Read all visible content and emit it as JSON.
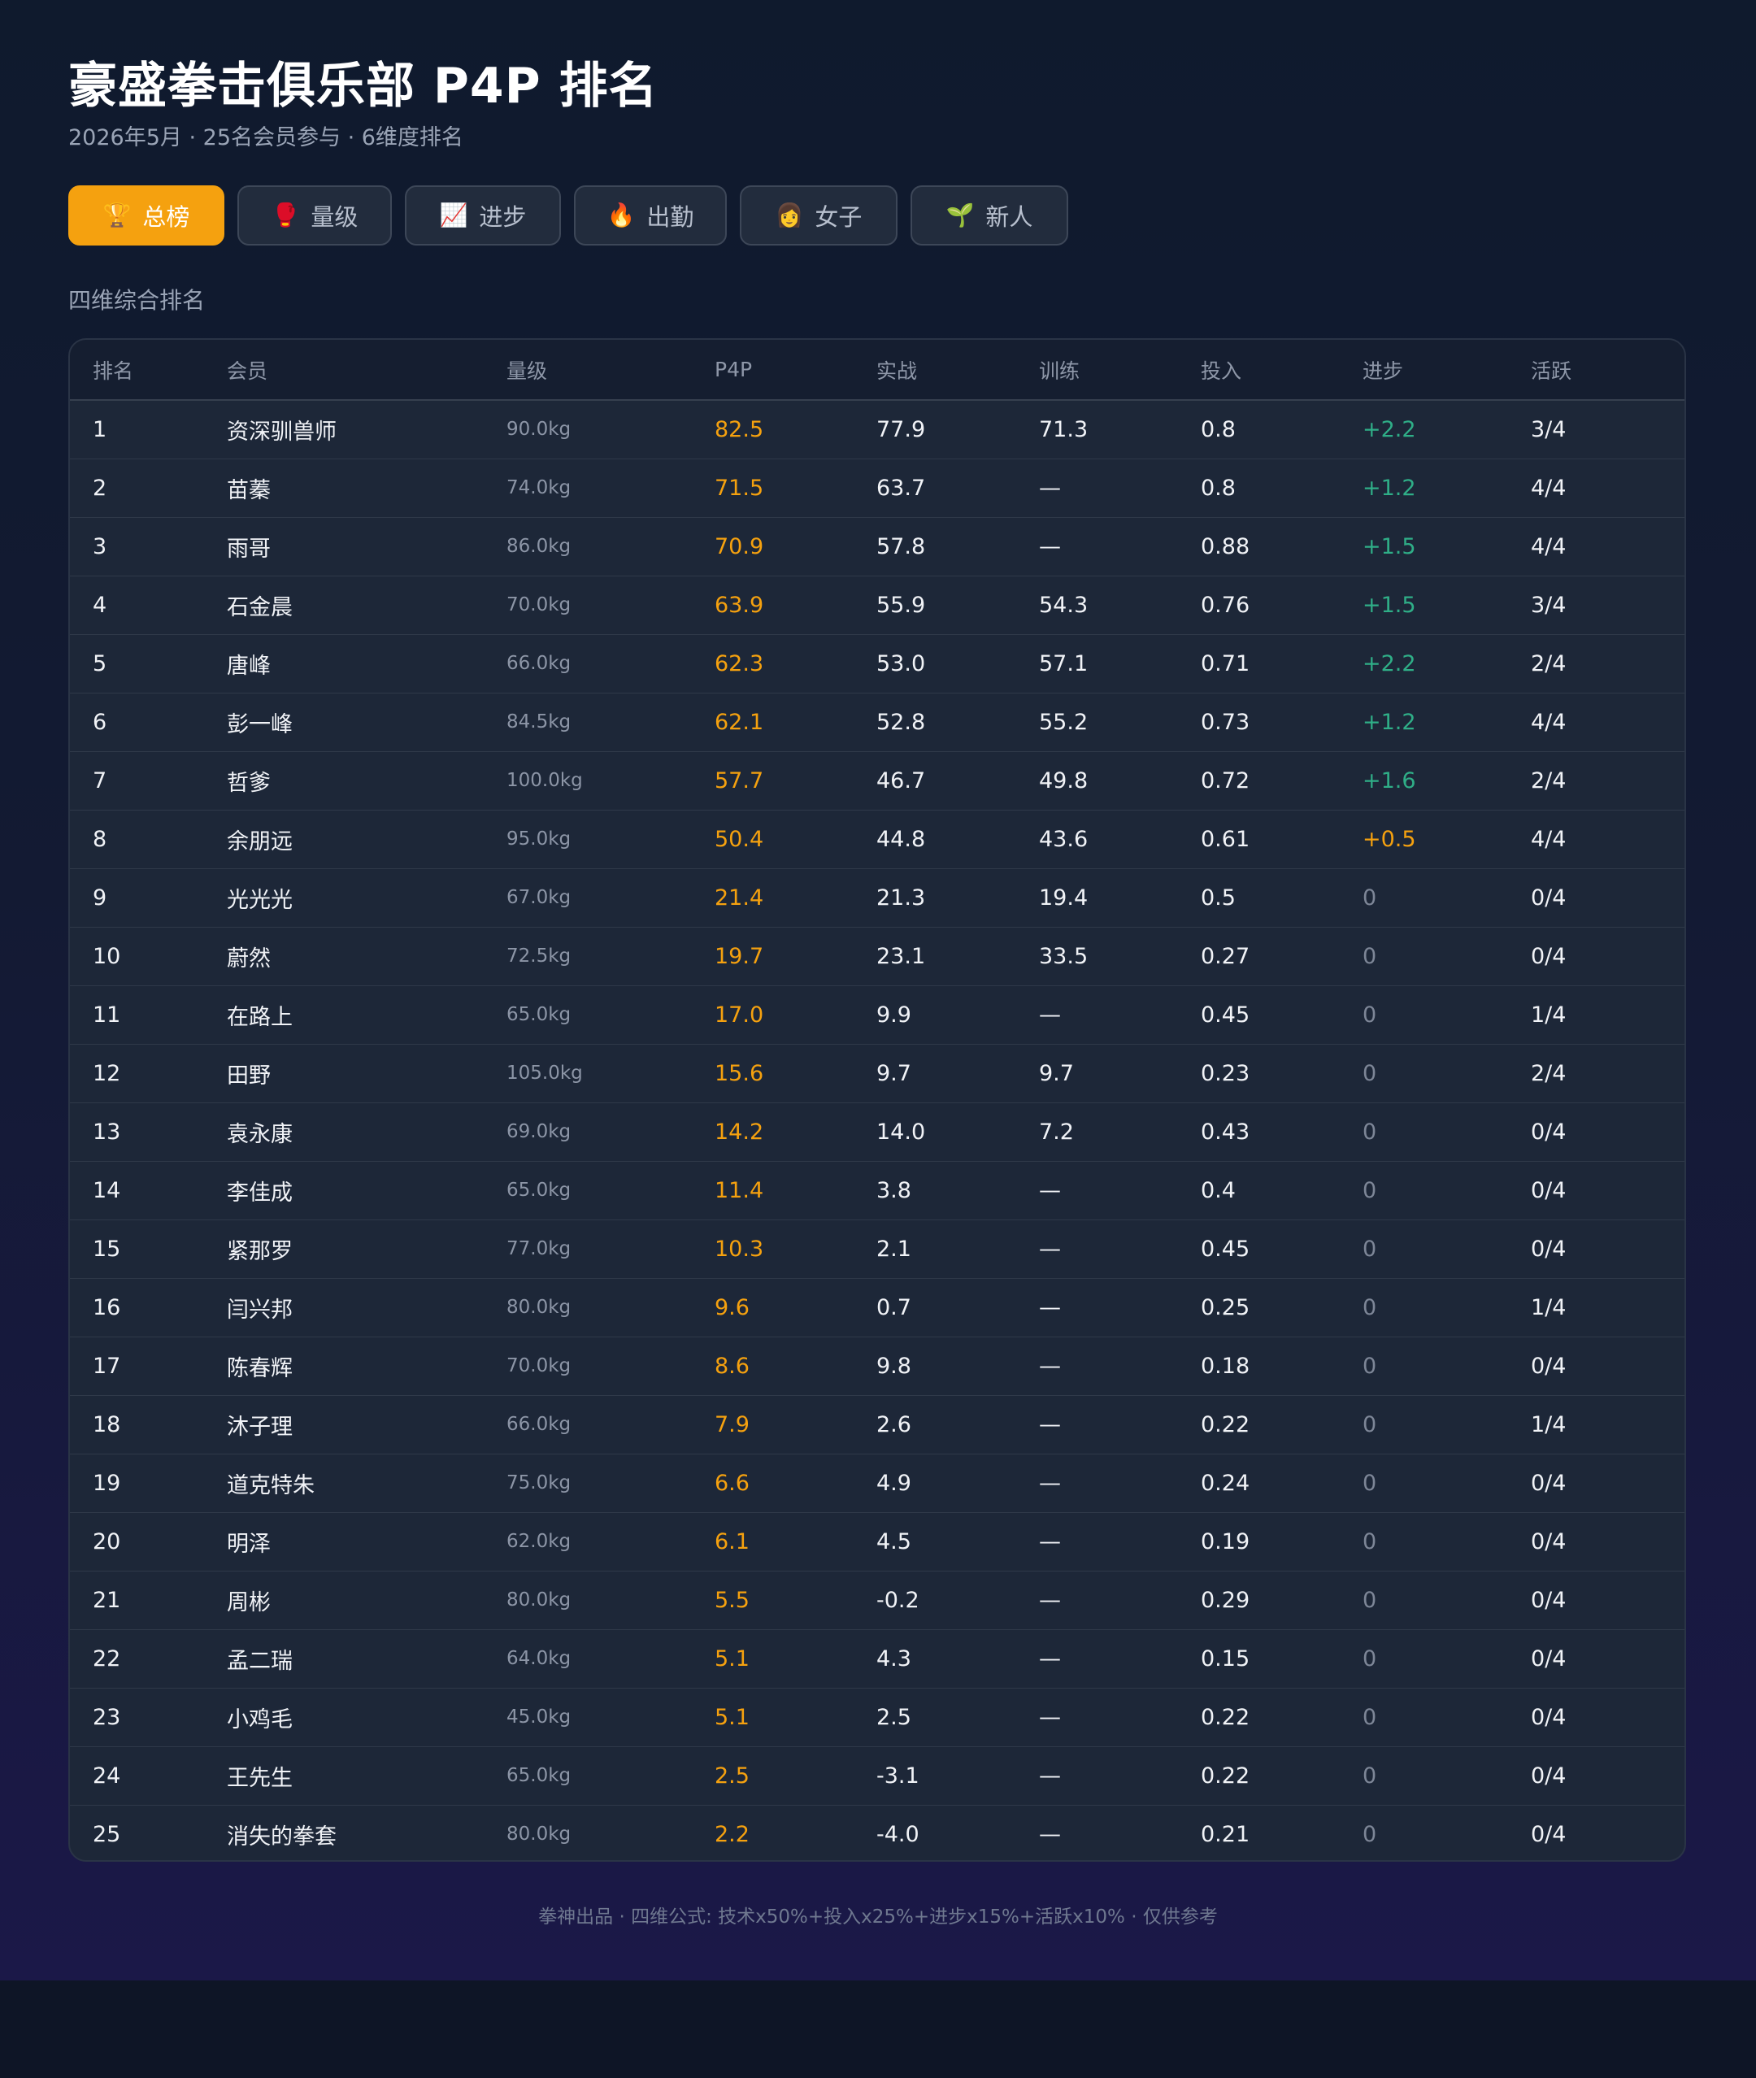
{
  "header": {
    "title": "豪盛拳击俱乐部 P4P 排名",
    "subtitle": "2026年5月 · 25名会员参与 · 6维度排名"
  },
  "tabs": [
    {
      "label": "总榜",
      "icon": "trophy-icon",
      "glyph": "🏆",
      "active": true
    },
    {
      "label": "量级",
      "icon": "boxing-glove-icon",
      "glyph": "🥊",
      "active": false
    },
    {
      "label": "进步",
      "icon": "chart-increasing-icon",
      "glyph": "📈",
      "active": false
    },
    {
      "label": "出勤",
      "icon": "fire-icon",
      "glyph": "🔥",
      "active": false
    },
    {
      "label": "女子",
      "icon": "woman-icon",
      "glyph": "👩",
      "active": false
    },
    {
      "label": "新人",
      "icon": "seedling-icon",
      "glyph": "🌱",
      "active": false
    }
  ],
  "section_label": "四维综合排名",
  "table": {
    "columns": [
      "排名",
      "会员",
      "量级",
      "P4P",
      "实战",
      "训练",
      "投入",
      "进步",
      "活跃"
    ],
    "rows": [
      [
        "1",
        "资深驯兽师",
        "90.0kg",
        "82.5",
        "77.9",
        "71.3",
        "0.8",
        "+2.2",
        "3/4"
      ],
      [
        "2",
        "苗蓁",
        "74.0kg",
        "71.5",
        "63.7",
        "—",
        "0.8",
        "+1.2",
        "4/4"
      ],
      [
        "3",
        "雨哥",
        "86.0kg",
        "70.9",
        "57.8",
        "—",
        "0.88",
        "+1.5",
        "4/4"
      ],
      [
        "4",
        "石金晨",
        "70.0kg",
        "63.9",
        "55.9",
        "54.3",
        "0.76",
        "+1.5",
        "3/4"
      ],
      [
        "5",
        "唐峰",
        "66.0kg",
        "62.3",
        "53.0",
        "57.1",
        "0.71",
        "+2.2",
        "2/4"
      ],
      [
        "6",
        "彭一峰",
        "84.5kg",
        "62.1",
        "52.8",
        "55.2",
        "0.73",
        "+1.2",
        "4/4"
      ],
      [
        "7",
        "哲爹",
        "100.0kg",
        "57.7",
        "46.7",
        "49.8",
        "0.72",
        "+1.6",
        "2/4"
      ],
      [
        "8",
        "余朋远",
        "95.0kg",
        "50.4",
        "44.8",
        "43.6",
        "0.61",
        "+0.5",
        "4/4"
      ],
      [
        "9",
        "光光光",
        "67.0kg",
        "21.4",
        "21.3",
        "19.4",
        "0.5",
        "0",
        "0/4"
      ],
      [
        "10",
        "蔚然",
        "72.5kg",
        "19.7",
        "23.1",
        "33.5",
        "0.27",
        "0",
        "0/4"
      ],
      [
        "11",
        "在路上",
        "65.0kg",
        "17.0",
        "9.9",
        "—",
        "0.45",
        "0",
        "1/4"
      ],
      [
        "12",
        "田野",
        "105.0kg",
        "15.6",
        "9.7",
        "9.7",
        "0.23",
        "0",
        "2/4"
      ],
      [
        "13",
        "袁永康",
        "69.0kg",
        "14.2",
        "14.0",
        "7.2",
        "0.43",
        "0",
        "0/4"
      ],
      [
        "14",
        "李佳成",
        "65.0kg",
        "11.4",
        "3.8",
        "—",
        "0.4",
        "0",
        "0/4"
      ],
      [
        "15",
        "紧那罗",
        "77.0kg",
        "10.3",
        "2.1",
        "—",
        "0.45",
        "0",
        "0/4"
      ],
      [
        "16",
        "闫兴邦",
        "80.0kg",
        "9.6",
        "0.7",
        "—",
        "0.25",
        "0",
        "1/4"
      ],
      [
        "17",
        "陈春辉",
        "70.0kg",
        "8.6",
        "9.8",
        "—",
        "0.18",
        "0",
        "0/4"
      ],
      [
        "18",
        "沐子理",
        "66.0kg",
        "7.9",
        "2.6",
        "—",
        "0.22",
        "0",
        "1/4"
      ],
      [
        "19",
        "道克特朱",
        "75.0kg",
        "6.6",
        "4.9",
        "—",
        "0.24",
        "0",
        "0/4"
      ],
      [
        "20",
        "明泽",
        "62.0kg",
        "6.1",
        "4.5",
        "—",
        "0.19",
        "0",
        "0/4"
      ],
      [
        "21",
        "周彬",
        "80.0kg",
        "5.5",
        "-0.2",
        "—",
        "0.29",
        "0",
        "0/4"
      ],
      [
        "22",
        "孟二瑞",
        "64.0kg",
        "5.1",
        "4.3",
        "—",
        "0.15",
        "0",
        "0/4"
      ],
      [
        "23",
        "小鸡毛",
        "45.0kg",
        "5.1",
        "2.5",
        "—",
        "0.22",
        "0",
        "0/4"
      ],
      [
        "24",
        "王先生",
        "65.0kg",
        "2.5",
        "-3.1",
        "—",
        "0.22",
        "0",
        "0/4"
      ],
      [
        "25",
        "消失的拳套",
        "80.0kg",
        "2.2",
        "-4.0",
        "—",
        "0.21",
        "0",
        "0/4"
      ]
    ]
  },
  "footer": "拳神出品 · 四维公式: 技术x50%+投入x25%+进步x15%+活跃x10% · 仅供参考",
  "colors": {
    "accent": "#f5a10f",
    "positive": "#2fae87",
    "muted": "#7d8697"
  }
}
